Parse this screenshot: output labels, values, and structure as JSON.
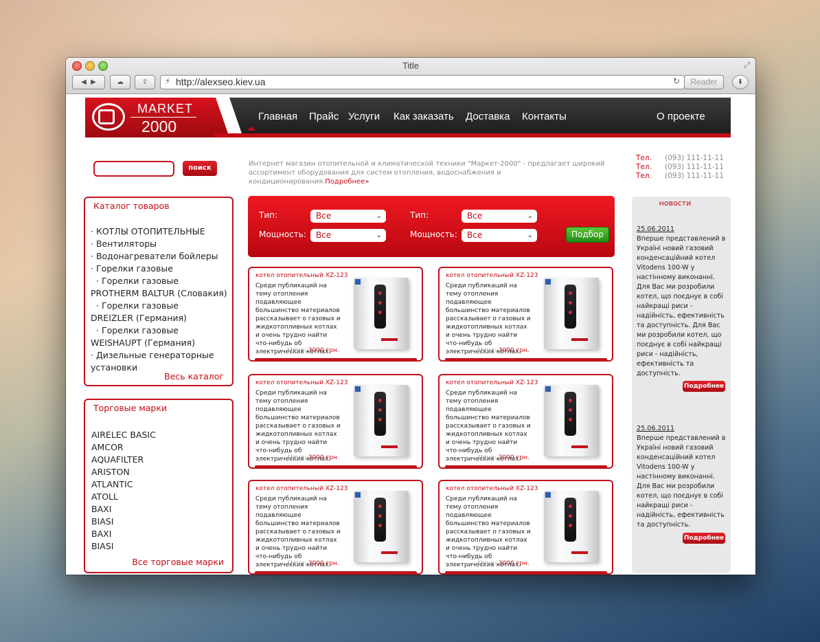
{
  "window": {
    "title": "Title",
    "url": "http://alexseo.kiev.ua",
    "reader_label": "Reader"
  },
  "logo": {
    "line1": "MARKET",
    "line2": "2000"
  },
  "nav": [
    "Главная",
    "Прайс",
    "Услуги",
    "Как заказать",
    "Доставка",
    "Контакты"
  ],
  "nav_about": "О проекте",
  "search": {
    "button": "поиск"
  },
  "intro": {
    "text": "Интернет магазин отопительной и климатической техники \"Маркет-2000\" - предлагает широкий ассортимент оборудования для систем отопления, водоснабжения и кондиционирования.",
    "more": "Подробнее»"
  },
  "phones": [
    {
      "label": "Тел.",
      "number": "(093) 111-11-11"
    },
    {
      "label": "Тел.",
      "number": "(093) 111-11-11"
    },
    {
      "label": "Тел.",
      "number": "(093) 111-11-11"
    }
  ],
  "catalog": {
    "title": "Каталог товаров",
    "items": [
      "· КОТЛЫ ОТОПИТЕЛЬНЫЕ",
      "· Вентиляторы",
      "· Водонагреватели бойлеры",
      "· Горелки газовые",
      "· Горелки газовые",
      "PROTHERM BALTUR (Словакия)",
      "· Горелки газовые",
      "DREIZLER (Германия)",
      "· Горелки газовые",
      "WEISHAUPT (Германия)",
      "· Дизельные генераторные",
      "установки"
    ],
    "link": "Весь каталог"
  },
  "brands": {
    "title": "Торговые марки",
    "items": [
      "AIRELEC BASIC",
      "AMCOR",
      "AQUAFILTER",
      "ARISTON",
      "ATLANTIC",
      "ATOLL",
      "BAXI",
      "BIASI",
      "BAXI",
      "BIASI"
    ],
    "link": "Все торговые марки"
  },
  "filter": {
    "type_label": "Тип:",
    "power_label": "Мощность:",
    "option_all": "Все",
    "button": "Подбор"
  },
  "products": [
    {
      "title": "котел отопительный XZ-123",
      "desc": "Среди публикаций на тему отопления подавляющее большинство материалов рассказывает о газовых и жидкотопливных котлах и очень трудно найти что-нибудь об электрических котлах.",
      "price_label": "Цена:",
      "price": "3000 грн."
    },
    {
      "title": "котел отопительный XZ-123",
      "desc": "Среди публикаций на тему отопления подавляющее большинство материалов рассказывает о газовых и жидкотопливных котлах и очень трудно найти что-нибудь об электрических котлах.",
      "price_label": "Цена:",
      "price": "3000 грн."
    },
    {
      "title": "котел отопительный XZ-123",
      "desc": "Среди публикаций на тему отопления подавляющее большинство материалов рассказывает о газовых и жидкотопливных котлах и очень трудно найти что-нибудь об электрических котлах.",
      "price_label": "Цена:",
      "price": "3000 грн."
    },
    {
      "title": "котел отопительный XZ-123",
      "desc": "Среди публикаций на тему отопления подавляющее большинство материалов рассказывает о газовых и жидкотопливных котлах и очень трудно найти что-нибудь об электрических котлах.",
      "price_label": "Цена:",
      "price": "3000 грн."
    },
    {
      "title": "котел отопительный XZ-123",
      "desc": "Среди публикаций на тему отопления подавляющее большинство материалов рассказывает о газовых и жидкотопливных котлах и очень трудно найти что-нибудь об электрических котлах.",
      "price_label": "Цена:",
      "price": "3000 грн."
    },
    {
      "title": "котел отопительный XZ-123",
      "desc": "Среди публикаций на тему отопления подавляющее большинство материалов рассказывает о газовых и жидкотопливных котлах и очень трудно найти что-нибудь об электрических котлах.",
      "price_label": "Цена:",
      "price": "3000 грн."
    }
  ],
  "news": {
    "title": "новости",
    "items": [
      {
        "date": "25.06.2011",
        "text": "Вперше представлений в Україні новий газовий конденсаційний котел Vitodens 100-W у настінному виконанні. Для Вас ми розробили котел, що поєднує в собі найкращі риси - надійність, ефективність та доступність. Для Вас ми розробили котел, що поєднує в собі найкращі риси - надійність, ефективність та доступність.",
        "more": "Подробнее"
      },
      {
        "date": "25.06.2011",
        "text": "Вперше представлений в Україні новий газовий конденсаційний котел Vitodens 100-W у настінному виконанні. Для Вас ми розробили котел, що поєднує в собі найкращі риси - надійність, ефективність та доступність.",
        "more": "Подробнее"
      }
    ]
  },
  "colors": {
    "brand_red": "#c30c16",
    "nav_dark": "#2b2b2b",
    "green_button": "#3aa51f"
  }
}
